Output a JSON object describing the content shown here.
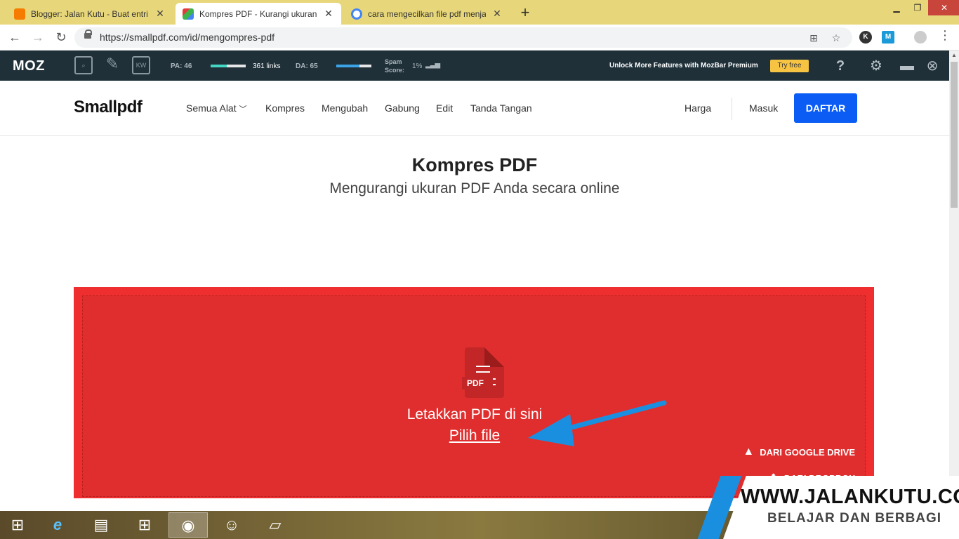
{
  "browser": {
    "tabs": [
      {
        "title": "Blogger: Jalan Kutu - Buat entri",
        "favicon_color": "#f57c00"
      },
      {
        "title": "Kompres PDF - Kurangi ukuran P",
        "favicon_color": "#e33b3b"
      },
      {
        "title": "cara mengecilkan file pdf menjad",
        "favicon_color": "#4285f4"
      }
    ],
    "new_tab": "+",
    "url": "https://smallpdf.com/id/mengompres-pdf"
  },
  "mozbar": {
    "logo": "MOZ",
    "pa_label": "PA: 46",
    "links": "361 links",
    "da_label": "DA: 65",
    "spam_label_1": "Spam",
    "spam_label_2": "Score:",
    "spam_value": "1%",
    "premium_text": "Unlock More Features with MozBar Premium",
    "try_free": "Try free",
    "help": "?"
  },
  "site": {
    "brand": "Smallpdf",
    "nav": [
      "Semua Alat",
      "Kompres",
      "Mengubah",
      "Gabung",
      "Edit",
      "Tanda Tangan"
    ],
    "pricing": "Harga",
    "login": "Masuk",
    "signup": "DAFTAR"
  },
  "hero": {
    "title": "Kompres PDF",
    "subtitle": "Mengurangi ukuran PDF Anda secara online"
  },
  "dropzone": {
    "file_tag": "PDF",
    "drop_text": "Letakkan PDF di sini",
    "pick_file": "Pilih file",
    "google_drive": "DARI GOOGLE DRIVE",
    "dropbox": "DARI DROPBOX"
  },
  "watermark": {
    "title": "WWW.JALANKUTU.COM",
    "subtitle": "BELAJAR DAN BERBAGI"
  },
  "colors": {
    "accent": "#0a5cf5",
    "dropzone": "#ef2f2f",
    "mozbar": "#1f3039"
  }
}
